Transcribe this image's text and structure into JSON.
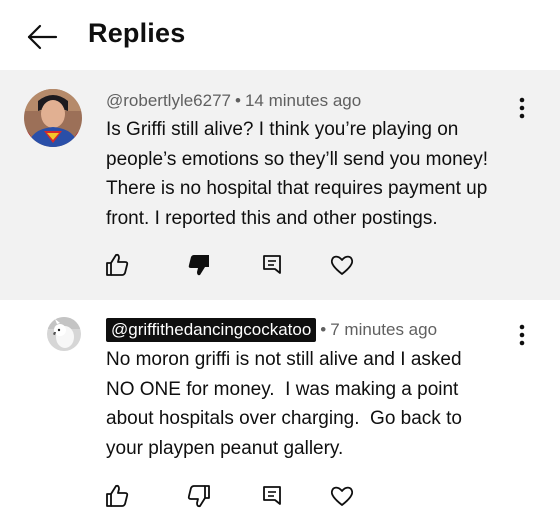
{
  "header": {
    "title": "Replies",
    "back_icon": "arrow-left-icon"
  },
  "comments": [
    {
      "handle": "@robertlyle6277",
      "separator": "•",
      "time": "14 minutes ago",
      "lines": [
        "Is Griffi still alive? I think you’re playing on",
        "people’s emotions so they’ll send you money!",
        "There is no hospital that requires payment up",
        "front. I reported this and other postings."
      ],
      "avatar": "superman-avatar",
      "disliked": true
    },
    {
      "handle": "@griffithedancingcockatoo",
      "separator": "•",
      "time": "7 minutes ago",
      "lines": [
        "No moron griffi is not still alive and I asked",
        "NO ONE for money.  I was making a point",
        "about hospitals over charging.  Go back to",
        "your playpen peanut gallery."
      ],
      "avatar": "cockatoo-avatar",
      "disliked": false
    }
  ],
  "icons": [
    "like-icon",
    "dislike-icon",
    "reply-icon",
    "heart-icon",
    "more-vert-icon"
  ],
  "colors": {
    "highlight_bg": "#f2f2f2",
    "text": "#0f0f0f",
    "meta": "#606060",
    "chip_bg": "#0f0f0f"
  }
}
